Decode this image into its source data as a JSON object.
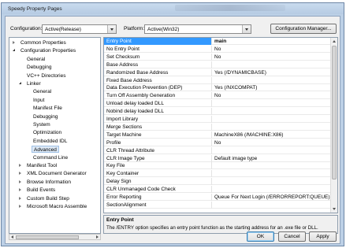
{
  "window": {
    "title": "Speedy Property Pages"
  },
  "toolbar": {
    "configuration_label": "Configuration:",
    "configuration_value": "Active(Release)",
    "platform_label": "Platform:",
    "platform_value": "Active(Win32)",
    "config_manager_label": "Configuration Manager..."
  },
  "tree": [
    {
      "label": "Common Properties",
      "level": 0,
      "expander": "closed"
    },
    {
      "label": "Configuration Properties",
      "level": 0,
      "expander": "open"
    },
    {
      "label": "General",
      "level": 1,
      "expander": "none"
    },
    {
      "label": "Debugging",
      "level": 1,
      "expander": "none"
    },
    {
      "label": "VC++ Directories",
      "level": 1,
      "expander": "none"
    },
    {
      "label": "Linker",
      "level": 1,
      "expander": "open"
    },
    {
      "label": "General",
      "level": 2,
      "expander": "none"
    },
    {
      "label": "Input",
      "level": 2,
      "expander": "none"
    },
    {
      "label": "Manifest File",
      "level": 2,
      "expander": "none"
    },
    {
      "label": "Debugging",
      "level": 2,
      "expander": "none"
    },
    {
      "label": "System",
      "level": 2,
      "expander": "none"
    },
    {
      "label": "Optimization",
      "level": 2,
      "expander": "none"
    },
    {
      "label": "Embedded IDL",
      "level": 2,
      "expander": "none"
    },
    {
      "label": "Advanced",
      "level": 2,
      "expander": "none",
      "selected": true
    },
    {
      "label": "Command Line",
      "level": 2,
      "expander": "none"
    },
    {
      "label": "Manifest Tool",
      "level": 1,
      "expander": "closed"
    },
    {
      "label": "XML Document Generator",
      "level": 1,
      "expander": "closed"
    },
    {
      "label": "Browse Information",
      "level": 1,
      "expander": "closed"
    },
    {
      "label": "Build Events",
      "level": 1,
      "expander": "closed"
    },
    {
      "label": "Custom Build Step",
      "level": 1,
      "expander": "closed"
    },
    {
      "label": "Microsoft Macro Assemble",
      "level": 1,
      "expander": "closed"
    }
  ],
  "properties": [
    {
      "name": "Entry Point",
      "value": "main",
      "selected": true
    },
    {
      "name": "No Entry Point",
      "value": "No"
    },
    {
      "name": "Set Checksum",
      "value": "No"
    },
    {
      "name": "Base Address",
      "value": ""
    },
    {
      "name": "Randomized Base Address",
      "value": "Yes (/DYNAMICBASE)"
    },
    {
      "name": "Fixed Base Address",
      "value": ""
    },
    {
      "name": "Data Execution Prevention (DEP)",
      "value": "Yes (/NXCOMPAT)"
    },
    {
      "name": "Turn Off Assembly Generation",
      "value": "No"
    },
    {
      "name": "Unload delay loaded DLL",
      "value": ""
    },
    {
      "name": "Nobind delay loaded DLL",
      "value": ""
    },
    {
      "name": "Import Library",
      "value": ""
    },
    {
      "name": "Merge Sections",
      "value": ""
    },
    {
      "name": "Target Machine",
      "value": "MachineX86 (/MACHINE:X86)"
    },
    {
      "name": "Profile",
      "value": "No"
    },
    {
      "name": "CLR Thread Attribute",
      "value": ""
    },
    {
      "name": "CLR Image Type",
      "value": "Default image type"
    },
    {
      "name": "Key File",
      "value": ""
    },
    {
      "name": "Key Container",
      "value": ""
    },
    {
      "name": "Delay Sign",
      "value": ""
    },
    {
      "name": "CLR Unmanaged Code Check",
      "value": ""
    },
    {
      "name": "Error Reporting",
      "value": "Queue For Next Login (/ERRORREPORT:QUEUE)"
    },
    {
      "name": "SectionAlignment",
      "value": ""
    }
  ],
  "description": {
    "title": "Entry Point",
    "text": "The /ENTRY option specifies an entry point function as the starting address for an .exe file or DLL."
  },
  "buttons": {
    "ok": "OK",
    "cancel": "Cancel",
    "apply": "Apply"
  }
}
